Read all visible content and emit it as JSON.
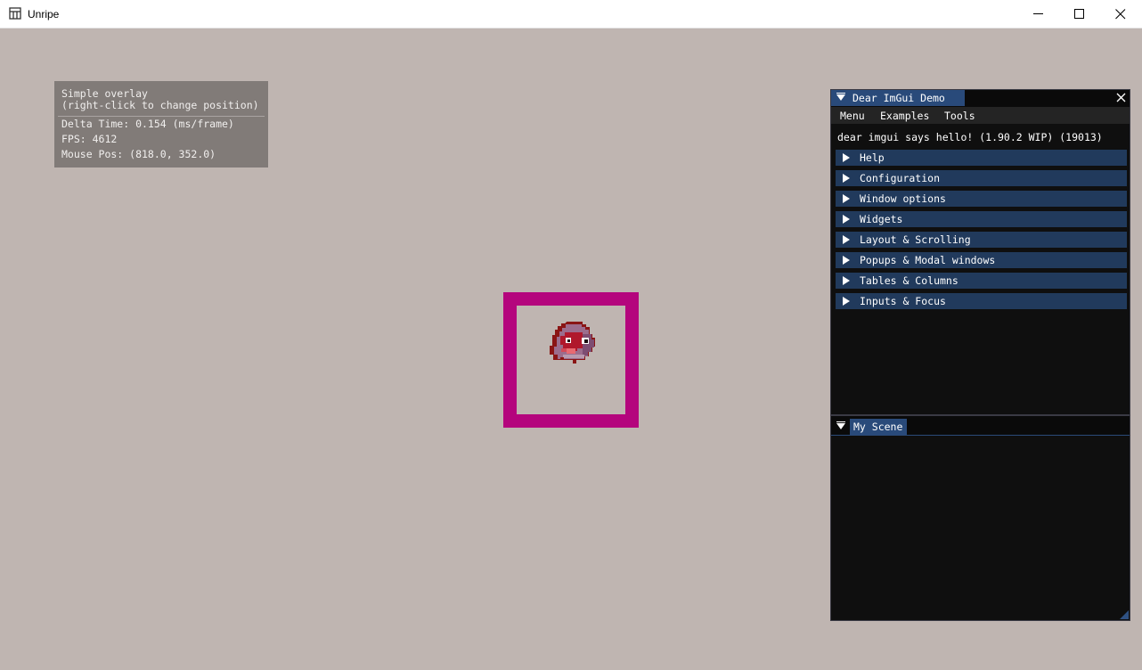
{
  "window": {
    "title": "Unripe"
  },
  "overlay": {
    "line1": "Simple overlay",
    "line2": "(right-click to change position)",
    "delta": "Delta Time: 0.154 (ms/frame)",
    "fps": "FPS: 4612",
    "mouse": "Mouse Pos: (818.0, 352.0)"
  },
  "demo": {
    "title": "Dear ImGui Demo",
    "menus": [
      "Menu",
      "Examples",
      "Tools"
    ],
    "hello": "dear imgui says hello! (1.90.2 WIP) (19013)",
    "sections": [
      "Help",
      "Configuration",
      "Window options",
      "Widgets",
      "Layout & Scrolling",
      "Popups & Modal windows",
      "Tables & Columns",
      "Inputs & Focus"
    ]
  },
  "scene": {
    "title": "My Scene"
  },
  "colors": {
    "accent": "#b4057d",
    "imgui_tab": "#294a7a",
    "imgui_header": "#213a5c"
  }
}
